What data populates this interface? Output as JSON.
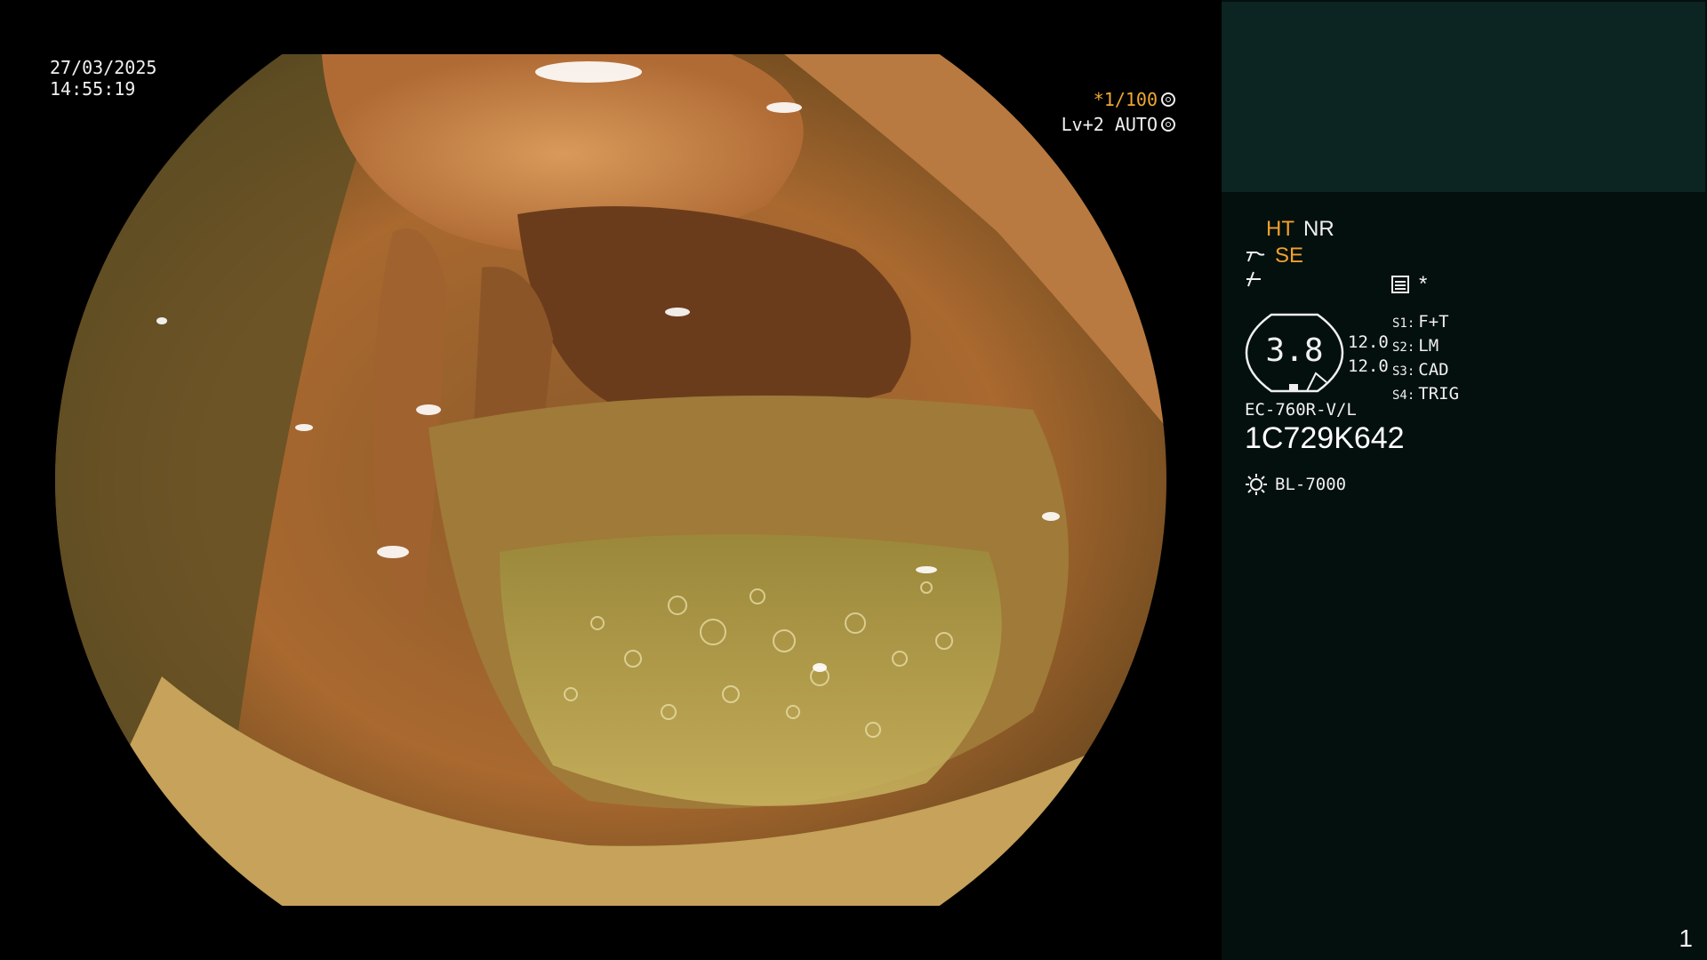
{
  "overlay": {
    "date": "27/03/2025",
    "time": "14:55:19",
    "shutter": "*1/100",
    "shutter_icon": "shutter-icon",
    "level": "Lv+2 AUTO",
    "level_icon": "auto-iris-icon"
  },
  "panel": {
    "ht_label": "HT",
    "nr_label": "NR",
    "se_label": "SE",
    "se_icon": "structure-enhance-icon",
    "color_icon": "color-mode-icon",
    "menu_icon": "menu-icon",
    "star": "*",
    "gauge_value": "3.8",
    "val1": "12.0",
    "val2": "12.0",
    "slots": [
      {
        "key": "S1:",
        "value": "F+T"
      },
      {
        "key": "S2:",
        "value": "LM"
      },
      {
        "key": "S3:",
        "value": "CAD"
      },
      {
        "key": "S4:",
        "value": "TRIG"
      }
    ],
    "scope_model": "EC-760R-V/L",
    "serial": "1C729K642",
    "light_source": "BL-7000",
    "light_icon": "light-source-icon",
    "page": "1"
  },
  "colors": {
    "accent_orange": "#f2a02a",
    "panel_top": "#0c2422",
    "panel_bg": "#04100e"
  }
}
